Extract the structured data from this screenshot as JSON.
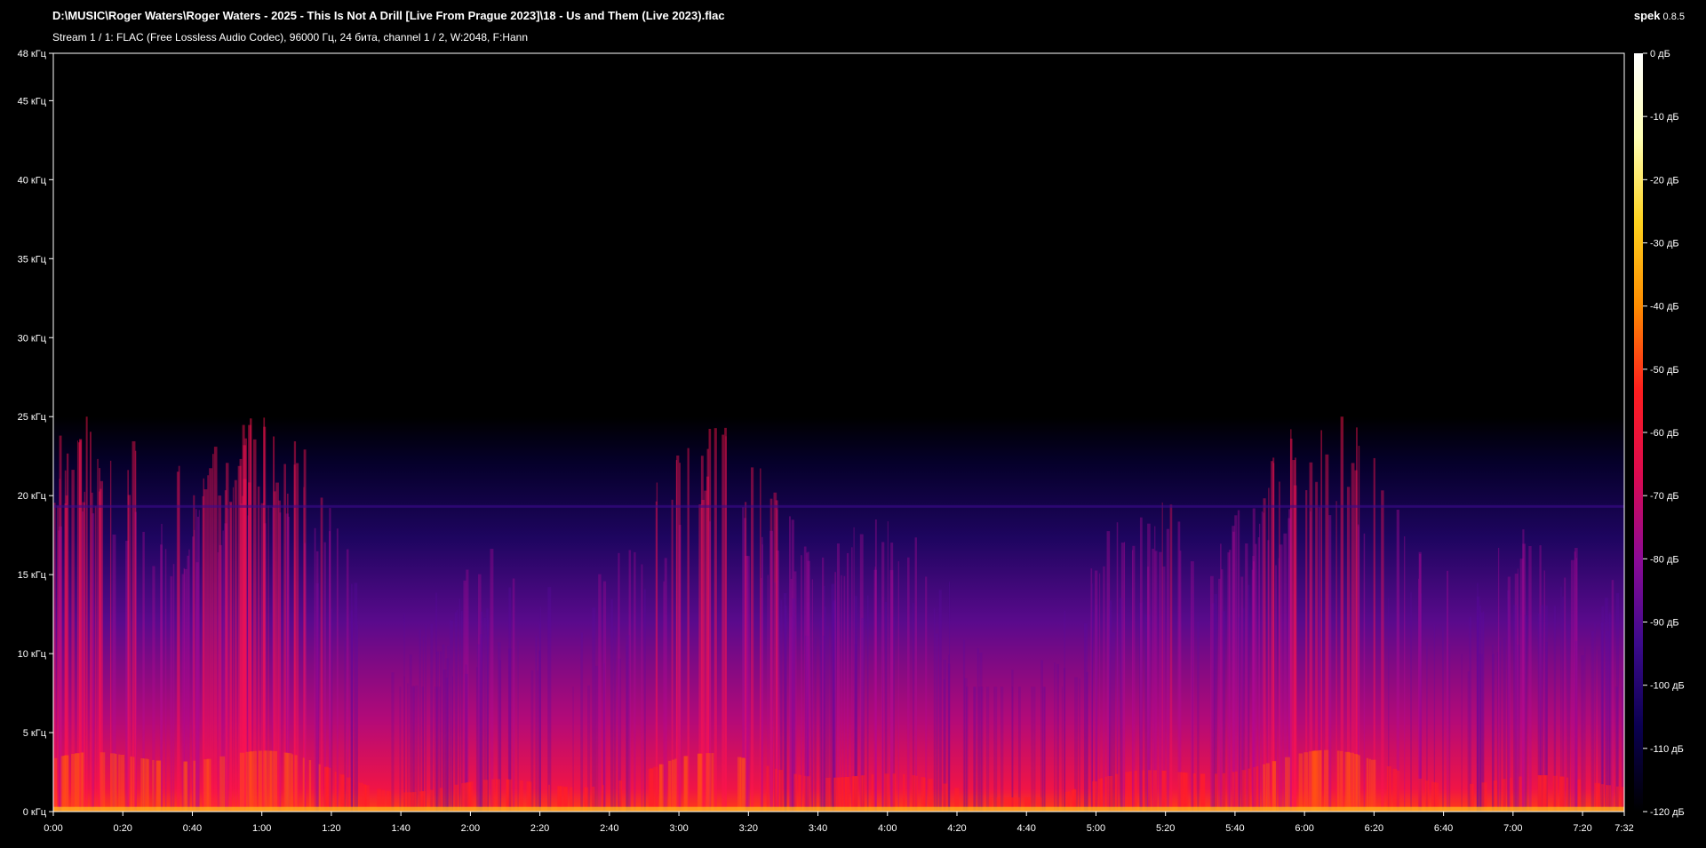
{
  "header": {
    "file_path": "D:\\MUSIC\\Roger Waters\\Roger Waters - 2025 - This Is Not A Drill [Live From Prague 2023]\\18 - Us and Them (Live 2023).flac",
    "stream_info": "Stream 1 / 1: FLAC (Free Lossless Audio Codec), 96000 Гц, 24 бита, channel 1 / 2, W:2048, F:Hann",
    "app_name": "spek",
    "app_version": "0.8.5"
  },
  "frequency_axis": {
    "unit": "кГц",
    "ticks": [
      {
        "value": 0,
        "label": "0 кГц"
      },
      {
        "value": 5,
        "label": "5 кГц"
      },
      {
        "value": 10,
        "label": "10 кГц"
      },
      {
        "value": 15,
        "label": "15 кГц"
      },
      {
        "value": 20,
        "label": "20 кГц"
      },
      {
        "value": 25,
        "label": "25 кГц"
      },
      {
        "value": 30,
        "label": "30 кГц"
      },
      {
        "value": 35,
        "label": "35 кГц"
      },
      {
        "value": 40,
        "label": "40 кГц"
      },
      {
        "value": 45,
        "label": "45 кГц"
      },
      {
        "value": 48,
        "label": "48 кГц"
      }
    ],
    "range": [
      0,
      48
    ]
  },
  "time_axis": {
    "duration_seconds": 452,
    "ticks": [
      {
        "value": 0,
        "label": "0:00"
      },
      {
        "value": 20,
        "label": "0:20"
      },
      {
        "value": 40,
        "label": "0:40"
      },
      {
        "value": 60,
        "label": "1:00"
      },
      {
        "value": 80,
        "label": "1:20"
      },
      {
        "value": 100,
        "label": "1:40"
      },
      {
        "value": 120,
        "label": "2:00"
      },
      {
        "value": 140,
        "label": "2:20"
      },
      {
        "value": 160,
        "label": "2:40"
      },
      {
        "value": 180,
        "label": "3:00"
      },
      {
        "value": 200,
        "label": "3:20"
      },
      {
        "value": 220,
        "label": "3:40"
      },
      {
        "value": 240,
        "label": "4:00"
      },
      {
        "value": 260,
        "label": "4:20"
      },
      {
        "value": 280,
        "label": "4:40"
      },
      {
        "value": 300,
        "label": "5:00"
      },
      {
        "value": 320,
        "label": "5:20"
      },
      {
        "value": 340,
        "label": "5:40"
      },
      {
        "value": 360,
        "label": "6:00"
      },
      {
        "value": 380,
        "label": "6:20"
      },
      {
        "value": 400,
        "label": "6:40"
      },
      {
        "value": 420,
        "label": "7:00"
      },
      {
        "value": 440,
        "label": "7:20"
      },
      {
        "value": 452,
        "label": "7:32"
      }
    ]
  },
  "db_scale": {
    "range": [
      -120,
      0
    ],
    "ticks": [
      {
        "value": 0,
        "label": "0 дБ"
      },
      {
        "value": -10,
        "label": "-10 дБ"
      },
      {
        "value": -20,
        "label": "-20 дБ"
      },
      {
        "value": -30,
        "label": "-30 дБ"
      },
      {
        "value": -40,
        "label": "-40 дБ"
      },
      {
        "value": -50,
        "label": "-50 дБ"
      },
      {
        "value": -60,
        "label": "-60 дБ"
      },
      {
        "value": -70,
        "label": "-70 дБ"
      },
      {
        "value": -80,
        "label": "-80 дБ"
      },
      {
        "value": -90,
        "label": "-90 дБ"
      },
      {
        "value": -100,
        "label": "-100 дБ"
      },
      {
        "value": -110,
        "label": "-110 дБ"
      },
      {
        "value": -120,
        "label": "-120 дБ"
      }
    ],
    "colormap": [
      "#000000",
      "#0a0050",
      "#3c0a8c",
      "#8c0a96",
      "#dc0a50",
      "#ff1e1e",
      "#ff8c00",
      "#ffd21e",
      "#ffffb4",
      "#ffffff"
    ]
  }
}
